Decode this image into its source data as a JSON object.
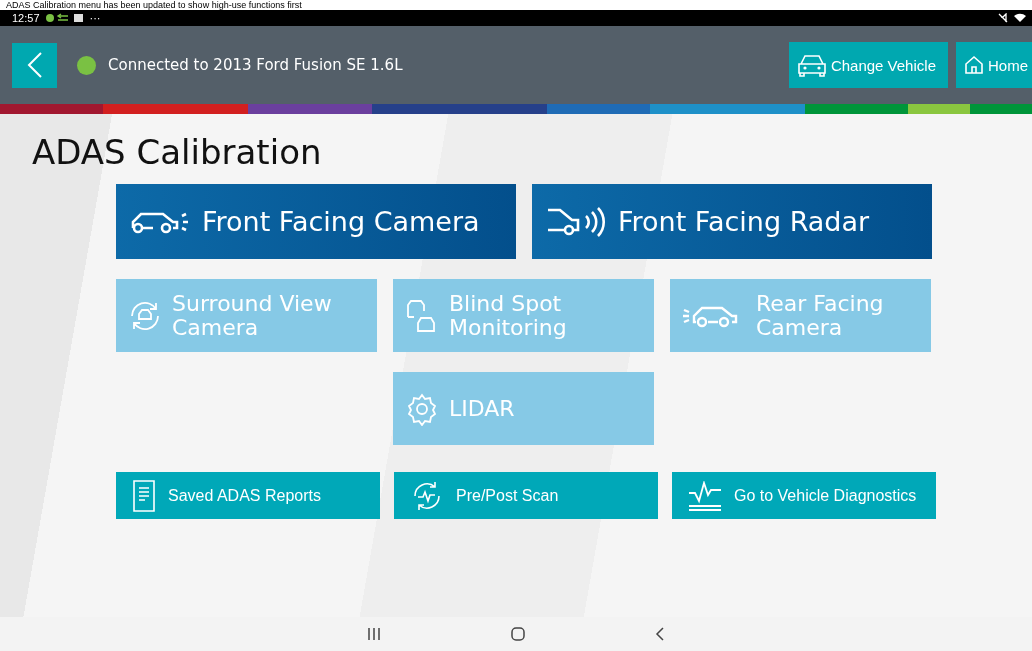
{
  "caption": "ADAS Calibration menu has been updated to show high-use functions first",
  "status_bar": {
    "time": "12:57",
    "more": "···"
  },
  "header": {
    "connected": true,
    "connection_text": "Connected to 2013 Ford Fusion SE 1.6L",
    "buttons": [
      "Change Vehicle",
      "Home"
    ]
  },
  "page_title": "ADAS Calibration",
  "primary_functions": [
    "Front Facing Camera",
    "Front Facing Radar"
  ],
  "secondary_functions": [
    {
      "lines": [
        "Surround View",
        "Camera"
      ]
    },
    {
      "lines": [
        "Blind Spot",
        "Monitoring"
      ]
    },
    {
      "lines": [
        "Rear Facing",
        "Camera"
      ]
    },
    {
      "lines": [
        "LIDAR"
      ]
    }
  ],
  "actions": [
    "Saved ADAS Reports",
    "Pre/Post Scan",
    "Go to Vehicle Diagnostics"
  ]
}
